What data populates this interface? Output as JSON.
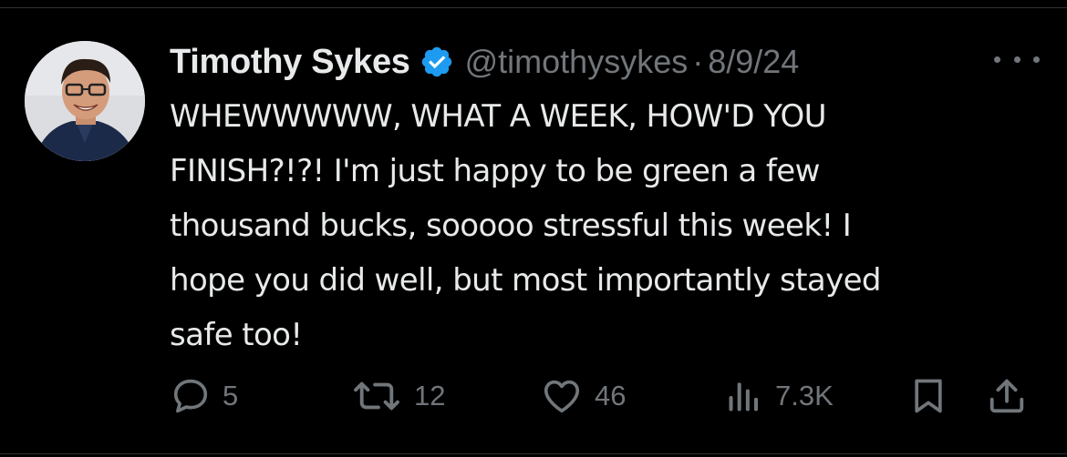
{
  "tweet": {
    "author": {
      "display_name": "Timothy Sykes",
      "handle": "@timothysykes",
      "verified": true
    },
    "separator": "·",
    "date": "8/9/24",
    "text": "WHEWWWWW, WHAT A WEEK, HOW'D YOU\nFINISH?!?! I'm just happy to be green a few\nthousand bucks, sooooo stressful this week! I\nhope you did well, but most importantly stayed\nsafe too!",
    "actions": {
      "replies": "5",
      "reposts": "12",
      "likes": "46",
      "views": "7.3K"
    }
  },
  "icons": {
    "more": "more-horizontal-icon",
    "reply": "reply-bubble-icon",
    "repost": "repost-arrows-icon",
    "like": "heart-icon",
    "views": "views-bar-chart-icon",
    "bookmark": "bookmark-icon",
    "share": "share-upload-icon",
    "verified": "verified-badge-icon"
  },
  "colors": {
    "background": "#000000",
    "text_primary": "#e7e9ea",
    "text_secondary": "#71767b",
    "verified_blue": "#1d9bf0",
    "divider": "#2f3336"
  }
}
